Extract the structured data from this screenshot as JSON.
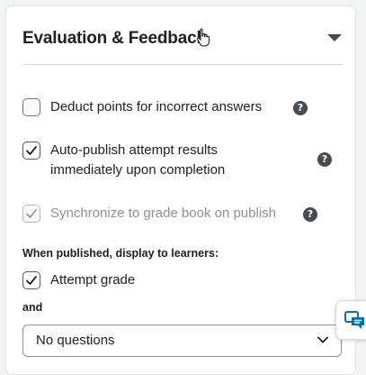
{
  "section": {
    "title": "Evaluation & Feedback"
  },
  "options": {
    "deduct_points": {
      "label": "Deduct points for incorrect answers",
      "checked": false
    },
    "auto_publish": {
      "label_line1": "Auto-publish attempt results",
      "label_line2": "immediately upon completion",
      "checked": true
    },
    "sync_gradebook": {
      "label": "Synchronize to grade book on publish",
      "checked": true,
      "disabled": true
    }
  },
  "display": {
    "heading": "When published, display to learners:",
    "attempt_grade": {
      "label": "Attempt grade",
      "checked": true
    },
    "and_label": "and",
    "questions_select": {
      "value": "No questions"
    }
  },
  "icons": {
    "help": "?",
    "cursor": "hand-pointer-icon",
    "chat": "chat-icon"
  },
  "colors": {
    "check": "#202122",
    "disabled": "#8d9195",
    "chat_accent": "#006fbf"
  }
}
